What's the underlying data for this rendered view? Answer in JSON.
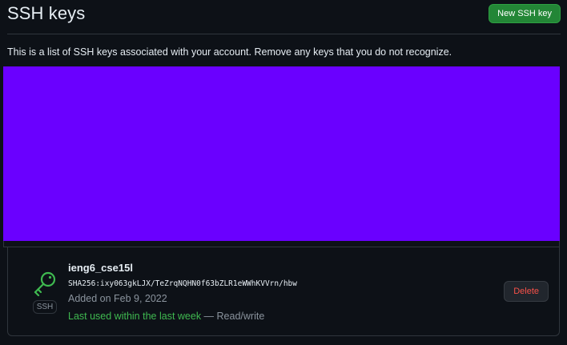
{
  "header": {
    "title": "SSH keys",
    "new_key_label": "New SSH key"
  },
  "intro_text": "This is a list of SSH keys associated with your account. Remove any keys that you do not recognize.",
  "colors": {
    "redacted_block": "#6a00ff",
    "accent_green": "#238636",
    "danger_red": "#f85149",
    "background": "#0d1117"
  },
  "keys": [
    {
      "icon": "key-icon",
      "type_badge": "SSH",
      "name": "ieng6_cse15l",
      "fingerprint": "SHA256:ixy063gkLJX/TeZrqNQHN0f63bZLR1eWWhKVVrn/hbw",
      "added": "Added on Feb 9, 2022",
      "last_used": "Last used within the last week",
      "separator": " — ",
      "access": "Read/write",
      "delete_label": "Delete"
    }
  ]
}
